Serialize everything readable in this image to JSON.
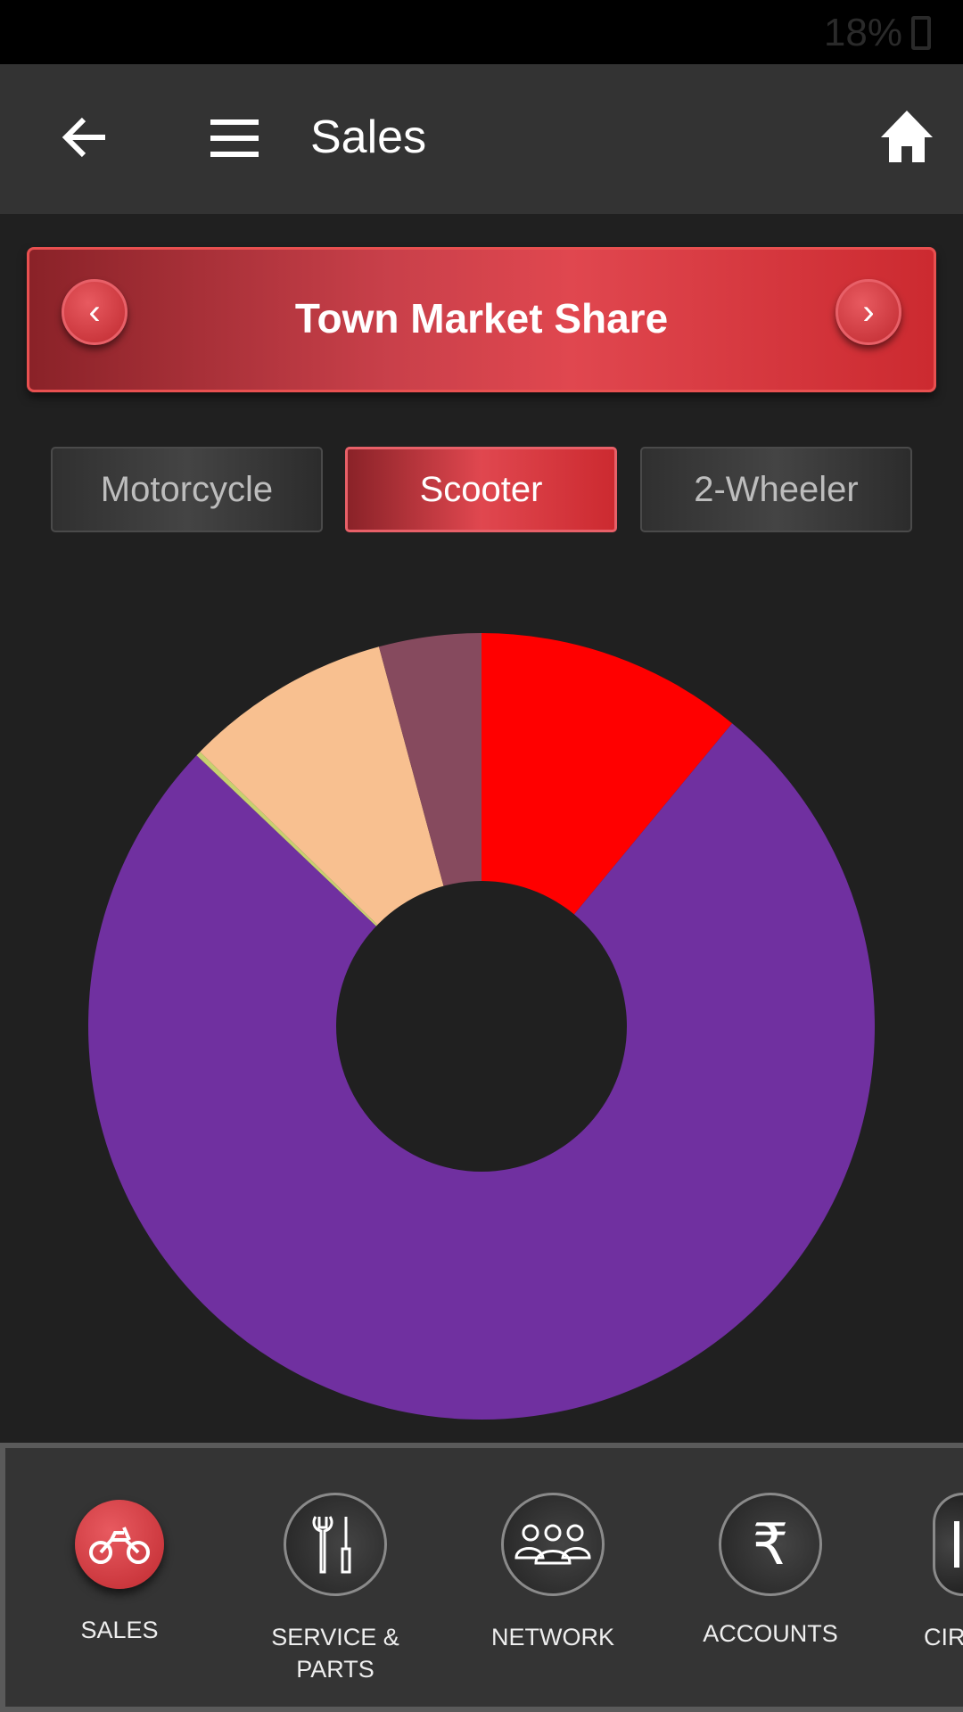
{
  "status_bar": {
    "battery": "18%"
  },
  "header": {
    "title": "Sales",
    "back_icon": "arrow-left-icon",
    "menu_icon": "hamburger-icon",
    "home_icon": "home-icon"
  },
  "banner": {
    "title": "Town Market Share",
    "prev_icon": "chevron-left-icon",
    "next_icon": "chevron-right-icon"
  },
  "tabs": [
    {
      "label": "Motorcycle",
      "active": false
    },
    {
      "label": "Scooter",
      "active": true
    },
    {
      "label": "2-Wheeler",
      "active": false
    }
  ],
  "chart_data": {
    "type": "pie",
    "donut": true,
    "legend": "none",
    "slices": [
      {
        "value": 11.0,
        "color": "#ff0000"
      },
      {
        "value": 76.1,
        "color": "#7030a0"
      },
      {
        "value": 0.2,
        "color": "#c8d070"
      },
      {
        "value": 8.5,
        "color": "#f8c090"
      },
      {
        "value": 4.2,
        "color": "#864a5e"
      }
    ]
  },
  "bottom_nav": [
    {
      "label": "SALES",
      "icon": "motorcycle-icon",
      "active": true
    },
    {
      "label": "SERVICE & PARTS",
      "icon": "tools-icon",
      "active": false
    },
    {
      "label": "NETWORK",
      "icon": "people-icon",
      "active": false
    },
    {
      "label": "ACCOUNTS",
      "icon": "rupee-icon",
      "active": false
    },
    {
      "label": "CIR",
      "icon": "document-icon",
      "active": false
    }
  ],
  "colors": {
    "accent": "#d8343c",
    "header_bg": "#333333",
    "page_bg": "#202020"
  }
}
